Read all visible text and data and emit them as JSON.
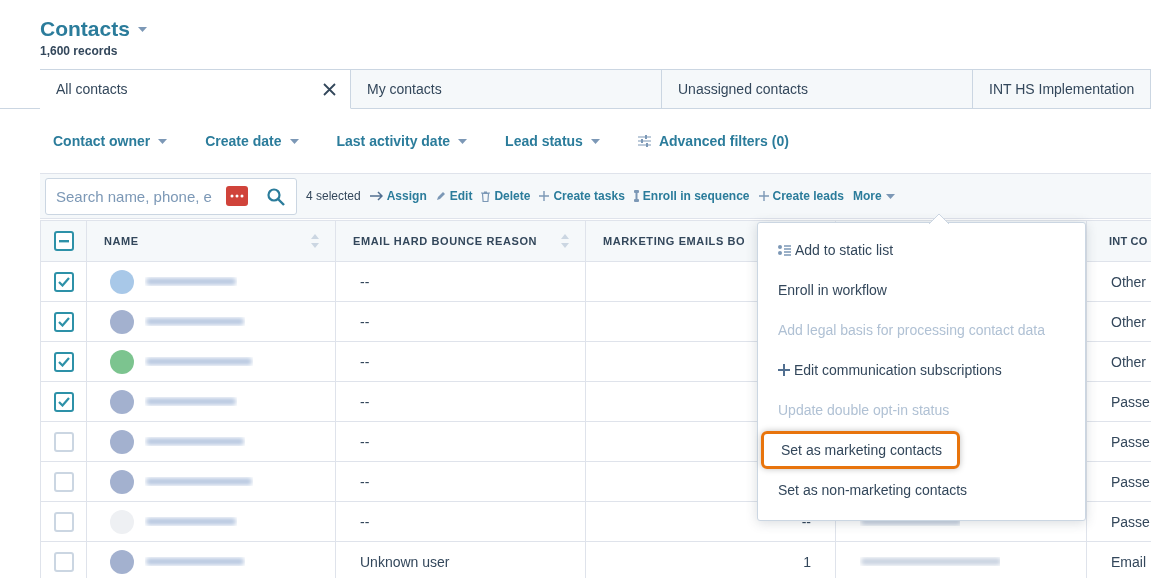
{
  "header": {
    "title": "Contacts",
    "record_count": "1,600 records"
  },
  "tabs": [
    {
      "label": "All contacts",
      "selected": true
    },
    {
      "label": "My contacts",
      "selected": false
    },
    {
      "label": "Unassigned contacts",
      "selected": false
    },
    {
      "label": "INT HS Implementation",
      "selected": false
    }
  ],
  "filters": [
    {
      "label": "Contact owner",
      "kind": "dropdown"
    },
    {
      "label": "Create date",
      "kind": "dropdown"
    },
    {
      "label": "Last activity date",
      "kind": "dropdown"
    },
    {
      "label": "Lead status",
      "kind": "dropdown"
    },
    {
      "label": "Advanced filters (0)",
      "kind": "advanced"
    }
  ],
  "toolbar": {
    "search": {
      "placeholder": "Search name, phone, e"
    },
    "selected_count": "4 selected",
    "actions": [
      {
        "label": "Assign",
        "kind": "arrow"
      },
      {
        "label": "Edit",
        "kind": "pencil"
      },
      {
        "label": "Delete",
        "kind": "trash"
      },
      {
        "label": "Create tasks",
        "kind": "plus"
      },
      {
        "label": "Enroll in sequence",
        "kind": "sequence"
      },
      {
        "label": "Create leads",
        "kind": "plus"
      },
      {
        "label": "More",
        "kind": "dropdown"
      }
    ]
  },
  "table": {
    "select_all": {
      "indeterminate": true
    },
    "columns": [
      {
        "label": "NAME",
        "sortable": true
      },
      {
        "label": "EMAIL HARD BOUNCE REASON",
        "sortable": true
      },
      {
        "label": "MARKETING EMAILS BO"
      },
      {
        "label": "INT CO"
      }
    ],
    "rows": [
      {
        "checked": true,
        "avatar": {
          "color": "#a8c8e8"
        },
        "hard_bounce_reason": "--",
        "column_5": "Other"
      },
      {
        "checked": true,
        "avatar": {
          "color": "#a3b1cf"
        },
        "hard_bounce_reason": "--",
        "column_5": "Other"
      },
      {
        "checked": true,
        "avatar": {
          "color": "#7cc48f"
        },
        "hard_bounce_reason": "--",
        "column_5": "Other"
      },
      {
        "checked": true,
        "avatar": {
          "color": "#a3b1cf"
        },
        "hard_bounce_reason": "--",
        "column_5": "Passe"
      },
      {
        "checked": false,
        "avatar": {
          "color": "#a3b1cf"
        },
        "hard_bounce_reason": "--",
        "column_5": "Passe"
      },
      {
        "checked": false,
        "avatar": {
          "color": "#a3b1cf"
        },
        "hard_bounce_reason": "--",
        "column_5": "Passe"
      },
      {
        "checked": false,
        "avatar": {
          "color": "#eef0f3"
        },
        "hard_bounce_reason": "--",
        "marketing_emails": "--",
        "column_4_blurred": true,
        "column_5": "Passe"
      },
      {
        "checked": false,
        "avatar": {
          "color": "#a3b1cf"
        },
        "hard_bounce_reason": "Unknown user",
        "marketing_emails": "1",
        "column_4_blurred": true,
        "column_5": "Email"
      }
    ]
  },
  "more_menu": {
    "items": [
      {
        "label": "Add to static list",
        "kind": "list",
        "disabled": false,
        "highlighted": false
      },
      {
        "label": "Enroll in workflow",
        "kind": "plain",
        "disabled": false,
        "highlighted": false
      },
      {
        "label": "Add legal basis for processing contact data",
        "kind": "plain",
        "disabled": true,
        "highlighted": false
      },
      {
        "label": "Edit communication subscriptions",
        "kind": "plus",
        "disabled": false,
        "highlighted": false
      },
      {
        "label": "Update double opt-in status",
        "kind": "plain",
        "disabled": true,
        "highlighted": false
      },
      {
        "label": "Set as marketing contacts",
        "kind": "plain",
        "disabled": false,
        "highlighted": true
      },
      {
        "label": "Set as non-marketing contacts",
        "kind": "plain",
        "disabled": false,
        "highlighted": false
      }
    ]
  }
}
